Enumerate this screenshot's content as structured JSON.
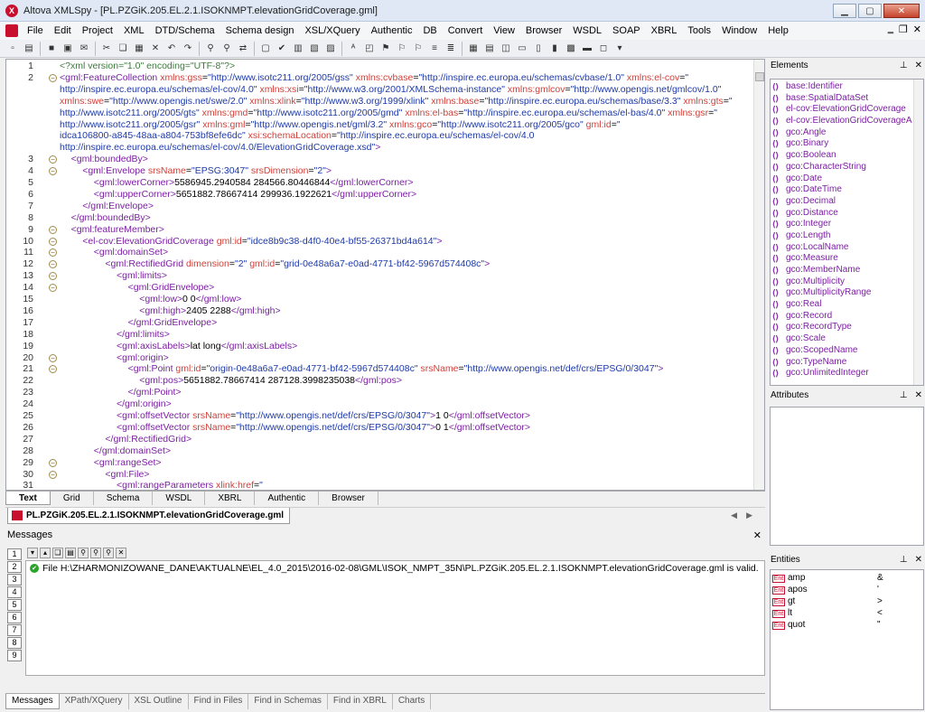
{
  "window": {
    "title": "Altova XMLSpy - [PL.PZGiK.205.EL.2.1.ISOKNMPT.elevationGridCoverage.gml]"
  },
  "menu": [
    "File",
    "Edit",
    "Project",
    "XML",
    "DTD/Schema",
    "Schema design",
    "XSL/XQuery",
    "Authentic",
    "DB",
    "Convert",
    "View",
    "Browser",
    "WSDL",
    "SOAP",
    "XBRL",
    "Tools",
    "Window",
    "Help"
  ],
  "code_lines": [
    {
      "n": "1",
      "indent": 0,
      "html": "<span class='pi'>&lt;?xml version=\"1.0\" encoding=\"UTF-8\"?&gt;</span>"
    },
    {
      "n": "2",
      "indent": 0,
      "fold": true,
      "html": "<span class='tg'>&lt;gml:FeatureCollection</span> <span class='attr'>xmlns:gss</span>=<span class='val'>\"http://www.isotc211.org/2005/gss\"</span> <span class='attr'>xmlns:cvbase</span>=<span class='val'>\"http://inspire.ec.europa.eu/schemas/cvbase/1.0\"</span> <span class='attr'>xmlns:el-cov</span>=<span class='val'>\"</span>"
    },
    {
      "n": "",
      "indent": 0,
      "html": "<span class='val'>http://inspire.ec.europa.eu/schemas/el-cov/4.0\"</span> <span class='attr'>xmlns:xsi</span>=<span class='val'>\"http://www.w3.org/2001/XMLSchema-instance\"</span> <span class='attr'>xmlns:gmlcov</span>=<span class='val'>\"http://www.opengis.net/gmlcov/1.0\"</span>"
    },
    {
      "n": "",
      "indent": 0,
      "html": "<span class='attr'>xmlns:swe</span>=<span class='val'>\"http://www.opengis.net/swe/2.0\"</span> <span class='attr'>xmlns:xlink</span>=<span class='val'>\"http://www.w3.org/1999/xlink\"</span> <span class='attr'>xmlns:base</span>=<span class='val'>\"http://inspire.ec.europa.eu/schemas/base/3.3\"</span> <span class='attr'>xmlns:gts</span>=<span class='val'>\"</span>"
    },
    {
      "n": "",
      "indent": 0,
      "html": "<span class='val'>http://www.isotc211.org/2005/gts\"</span> <span class='attr'>xmlns:gmd</span>=<span class='val'>\"http://www.isotc211.org/2005/gmd\"</span> <span class='attr'>xmlns:el-bas</span>=<span class='val'>\"http://inspire.ec.europa.eu/schemas/el-bas/4.0\"</span> <span class='attr'>xmlns:gsr</span>=<span class='val'>\"</span>"
    },
    {
      "n": "",
      "indent": 0,
      "html": "<span class='val'>http://www.isotc211.org/2005/gsr\"</span> <span class='attr'>xmlns:gml</span>=<span class='val'>\"http://www.opengis.net/gml/3.2\"</span> <span class='attr'>xmlns:gco</span>=<span class='val'>\"http://www.isotc211.org/2005/gco\"</span> <span class='attr'>gml:id</span>=<span class='val'>\"</span>"
    },
    {
      "n": "",
      "indent": 0,
      "html": "<span class='val'>idca106800-a845-48aa-a804-753bf8efe6dc\"</span> <span class='attr'>xsi:schemaLocation</span>=<span class='val'>\"http://inspire.ec.europa.eu/schemas/el-cov/4.0</span>"
    },
    {
      "n": "",
      "indent": 0,
      "html": "<span class='val'>http://inspire.ec.europa.eu/schemas/el-cov/4.0/ElevationGridCoverage.xsd\"</span><span class='tg'>&gt;</span>"
    },
    {
      "n": "3",
      "indent": 1,
      "fold": true,
      "html": "<span class='tg'>&lt;gml:boundedBy&gt;</span>"
    },
    {
      "n": "4",
      "indent": 2,
      "fold": true,
      "html": "<span class='tg'>&lt;gml:Envelope</span> <span class='attr'>srsName</span>=<span class='val'>\"EPSG:3047\"</span> <span class='attr'>srsDimension</span>=<span class='val'>\"2\"</span><span class='tg'>&gt;</span>"
    },
    {
      "n": "5",
      "indent": 3,
      "html": "<span class='tg'>&lt;gml:lowerCorner&gt;</span>5586945.2940584 284566.80446844<span class='tg'>&lt;/gml:lowerCorner&gt;</span>"
    },
    {
      "n": "6",
      "indent": 3,
      "html": "<span class='tg'>&lt;gml:upperCorner&gt;</span>5651882.78667414 299936.1922621<span class='tg'>&lt;/gml:upperCorner&gt;</span>"
    },
    {
      "n": "7",
      "indent": 2,
      "html": "<span class='tg'>&lt;/gml:Envelope&gt;</span>"
    },
    {
      "n": "8",
      "indent": 1,
      "html": "<span class='tg'>&lt;/gml:boundedBy&gt;</span>"
    },
    {
      "n": "9",
      "indent": 1,
      "fold": true,
      "html": "<span class='tg'>&lt;gml:featureMember&gt;</span>"
    },
    {
      "n": "10",
      "indent": 2,
      "fold": true,
      "html": "<span class='tg'>&lt;el-cov:ElevationGridCoverage</span> <span class='attr'>gml:id</span>=<span class='val'>\"idce8b9c38-d4f0-40e4-bf55-26371bd4a614\"</span><span class='tg'>&gt;</span>"
    },
    {
      "n": "11",
      "indent": 3,
      "fold": true,
      "html": "<span class='tg'>&lt;gml:domainSet&gt;</span>"
    },
    {
      "n": "12",
      "indent": 4,
      "fold": true,
      "html": "<span class='tg'>&lt;gml:RectifiedGrid</span> <span class='attr'>dimension</span>=<span class='val'>\"2\"</span> <span class='attr'>gml:id</span>=<span class='val'>\"grid-0e48a6a7-e0ad-4771-bf42-5967d574408c\"</span><span class='tg'>&gt;</span>"
    },
    {
      "n": "13",
      "indent": 5,
      "fold": true,
      "html": "<span class='tg'>&lt;gml:limits&gt;</span>"
    },
    {
      "n": "14",
      "indent": 6,
      "fold": true,
      "html": "<span class='tg'>&lt;gml:GridEnvelope&gt;</span>"
    },
    {
      "n": "15",
      "indent": 7,
      "html": "<span class='tg'>&lt;gml:low&gt;</span>0 0<span class='tg'>&lt;/gml:low&gt;</span>"
    },
    {
      "n": "16",
      "indent": 7,
      "html": "<span class='tg'>&lt;gml:high&gt;</span>2405 2288<span class='tg'>&lt;/gml:high&gt;</span>"
    },
    {
      "n": "17",
      "indent": 6,
      "html": "<span class='tg'>&lt;/gml:GridEnvelope&gt;</span>"
    },
    {
      "n": "18",
      "indent": 5,
      "html": "<span class='tg'>&lt;/gml:limits&gt;</span>"
    },
    {
      "n": "19",
      "indent": 5,
      "html": "<span class='tg'>&lt;gml:axisLabels&gt;</span>lat long<span class='tg'>&lt;/gml:axisLabels&gt;</span>"
    },
    {
      "n": "20",
      "indent": 5,
      "fold": true,
      "html": "<span class='tg'>&lt;gml:origin&gt;</span>"
    },
    {
      "n": "21",
      "indent": 6,
      "fold": true,
      "html": "<span class='tg'>&lt;gml:Point</span> <span class='attr'>gml:id</span>=<span class='val'>\"origin-0e48a6a7-e0ad-4771-bf42-5967d574408c\"</span> <span class='attr'>srsName</span>=<span class='val'>\"http://www.opengis.net/def/crs/EPSG/0/3047\"</span><span class='tg'>&gt;</span>"
    },
    {
      "n": "22",
      "indent": 7,
      "html": "<span class='tg'>&lt;gml:pos&gt;</span>5651882.78667414 287128.3998235038<span class='tg'>&lt;/gml:pos&gt;</span>"
    },
    {
      "n": "23",
      "indent": 6,
      "html": "<span class='tg'>&lt;/gml:Point&gt;</span>"
    },
    {
      "n": "24",
      "indent": 5,
      "html": "<span class='tg'>&lt;/gml:origin&gt;</span>"
    },
    {
      "n": "25",
      "indent": 5,
      "html": "<span class='tg'>&lt;gml:offsetVector</span> <span class='attr'>srsName</span>=<span class='val'>\"http://www.opengis.net/def/crs/EPSG/0/3047\"</span><span class='tg'>&gt;</span>1 0<span class='tg'>&lt;/gml:offsetVector&gt;</span>"
    },
    {
      "n": "26",
      "indent": 5,
      "html": "<span class='tg'>&lt;gml:offsetVector</span> <span class='attr'>srsName</span>=<span class='val'>\"http://www.opengis.net/def/crs/EPSG/0/3047\"</span><span class='tg'>&gt;</span>0 1<span class='tg'>&lt;/gml:offsetVector&gt;</span>"
    },
    {
      "n": "27",
      "indent": 4,
      "html": "<span class='tg'>&lt;/gml:RectifiedGrid&gt;</span>"
    },
    {
      "n": "28",
      "indent": 3,
      "html": "<span class='tg'>&lt;/gml:domainSet&gt;</span>"
    },
    {
      "n": "29",
      "indent": 3,
      "fold": true,
      "html": "<span class='tg'>&lt;gml:rangeSet&gt;</span>"
    },
    {
      "n": "30",
      "indent": 4,
      "fold": true,
      "html": "<span class='tg'>&lt;gml:File&gt;</span>"
    },
    {
      "n": "31",
      "indent": 5,
      "html": "<span class='tg'>&lt;gml:rangeParameters</span> <span class='attr'>xlink:href</span>=<span class='val'>\"</span>"
    }
  ],
  "view_tabs": [
    "Text",
    "Grid",
    "Schema",
    "WSDL",
    "XBRL",
    "Authentic",
    "Browser"
  ],
  "doc_tab": "PL.PZGiK.205.EL.2.1.ISOKNMPT.elevationGridCoverage.gml",
  "messages": {
    "title": "Messages",
    "vertical_tabs": [
      "1",
      "2",
      "3",
      "4",
      "5",
      "6",
      "7",
      "8",
      "9"
    ],
    "text": "File H:\\ZHARMONIZOWANE_DANE\\AKTUALNE\\EL_4.0_2015\\2016-02-08\\GML\\ISOK_NMPT_35N\\PL.PZGiK.205.EL.2.1.ISOKNMPT.elevationGridCoverage.gml is valid."
  },
  "bottom_tabs": [
    "Messages",
    "XPath/XQuery",
    "XSL Outline",
    "Find in Files",
    "Find in Schemas",
    "Find in XBRL",
    "Charts"
  ],
  "elements": {
    "title": "Elements",
    "items": [
      "base:Identifier",
      "base:SpatialDataSet",
      "el-cov:ElevationGridCoverage",
      "el-cov:ElevationGridCoverageA",
      "gco:Angle",
      "gco:Binary",
      "gco:Boolean",
      "gco:CharacterString",
      "gco:Date",
      "gco:DateTime",
      "gco:Decimal",
      "gco:Distance",
      "gco:Integer",
      "gco:Length",
      "gco:LocalName",
      "gco:Measure",
      "gco:MemberName",
      "gco:Multiplicity",
      "gco:MultiplicityRange",
      "gco:Real",
      "gco:Record",
      "gco:RecordType",
      "gco:Scale",
      "gco:ScopedName",
      "gco:TypeName",
      "gco:UnlimitedInteger"
    ]
  },
  "attributes": {
    "title": "Attributes"
  },
  "entities": {
    "title": "Entities",
    "items": [
      {
        "name": "amp",
        "value": "&"
      },
      {
        "name": "apos",
        "value": "'"
      },
      {
        "name": "gt",
        "value": ">"
      },
      {
        "name": "lt",
        "value": "<"
      },
      {
        "name": "quot",
        "value": "\""
      }
    ]
  }
}
